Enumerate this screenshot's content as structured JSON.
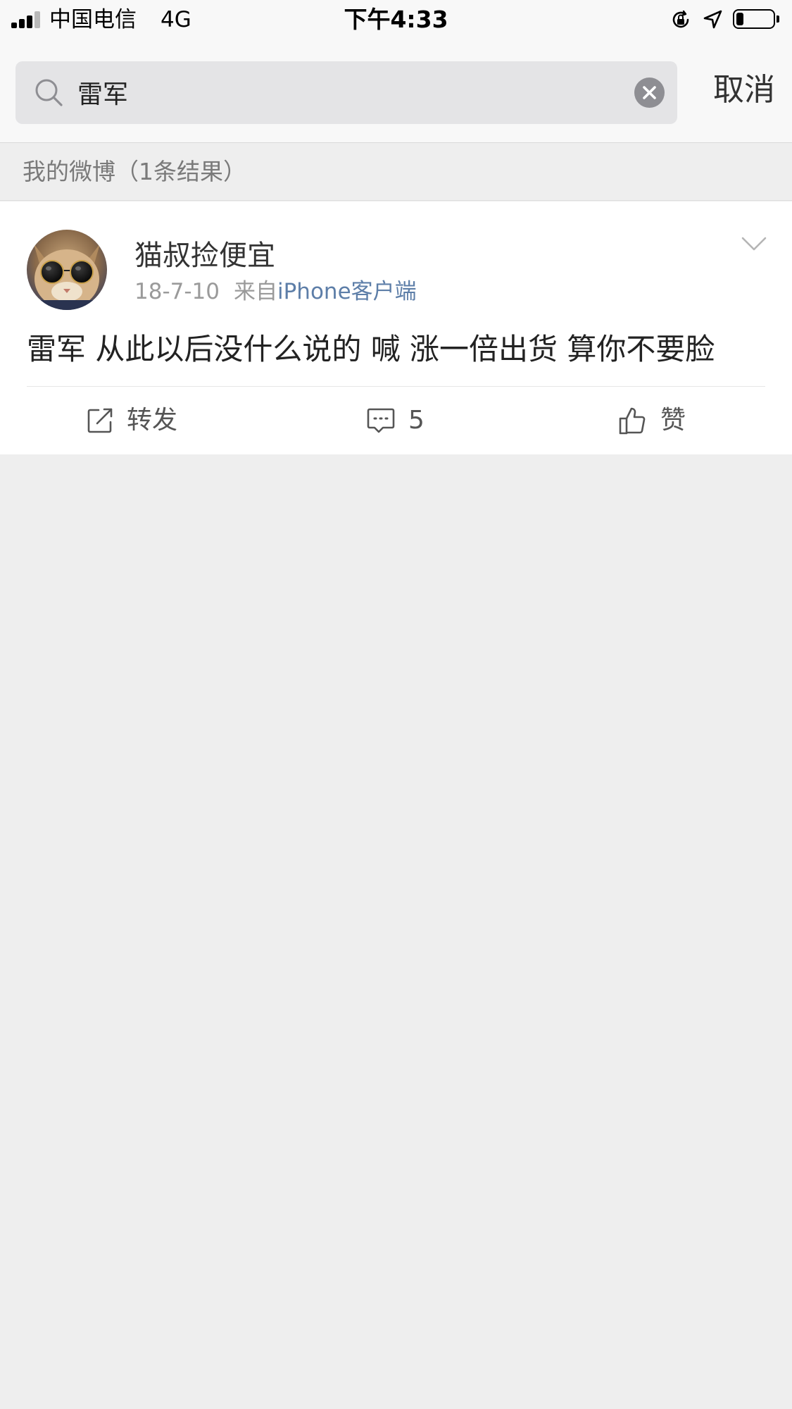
{
  "status_bar": {
    "carrier": "中国电信",
    "network": "4G",
    "time": "下午4:33",
    "battery_level": 0.2,
    "icons": [
      "signal-icon",
      "orientation-lock-icon",
      "location-icon",
      "battery-icon"
    ]
  },
  "search": {
    "query": "雷军",
    "cancel_label": "取消",
    "icons": [
      "search-icon",
      "clear-icon"
    ]
  },
  "results": {
    "label": "我的微博（1条结果）"
  },
  "post": {
    "username": "猫叔捡便宜",
    "date": "18-7-10",
    "source_prefix": "来自",
    "source": "iPhone客户端",
    "text": "雷军 从此以后没什么说的 喊 涨一倍出货 算你不要脸",
    "actions": {
      "repost_label": "转发",
      "comment_count": "5",
      "like_label": "赞"
    }
  },
  "colors": {
    "background": "#eeeeee",
    "header": "#f8f8f8",
    "card": "#ffffff",
    "link": "#5d7ea8",
    "muted_text": "#9a9a9a"
  }
}
